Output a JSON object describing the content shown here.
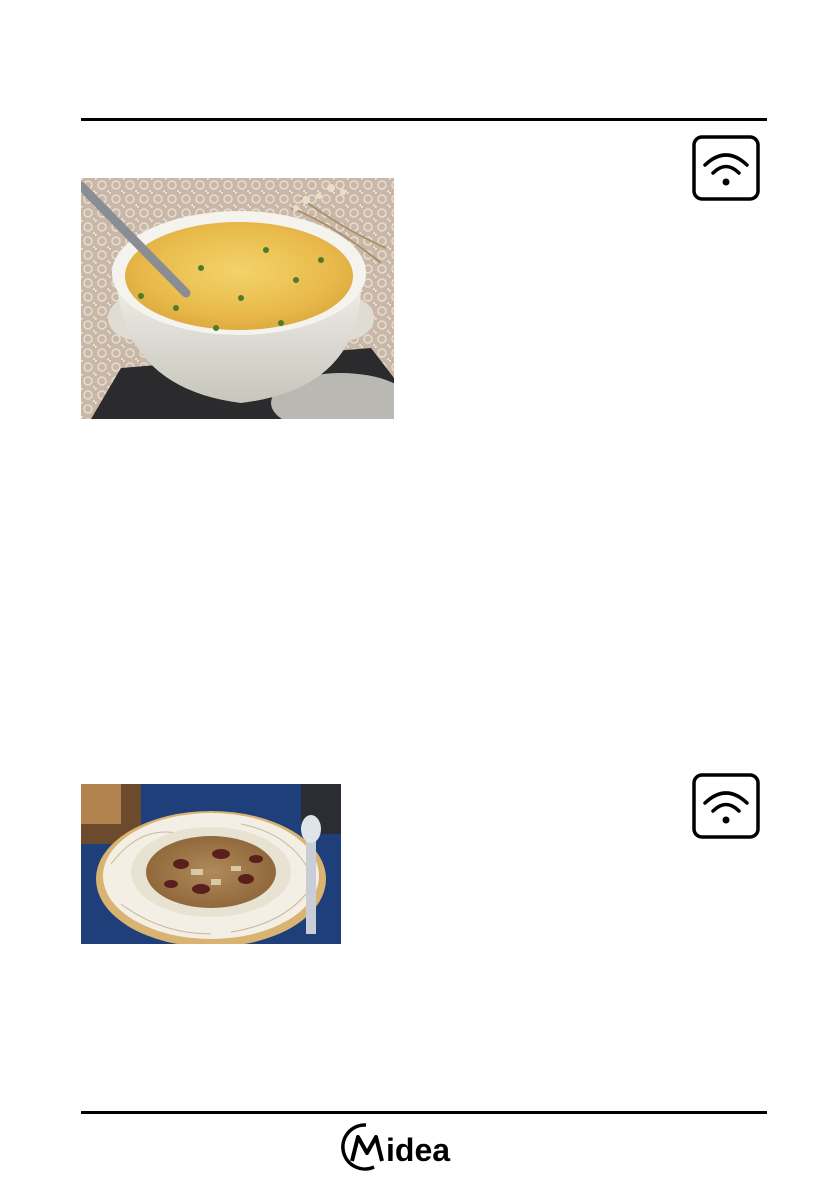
{
  "header": {
    "divider": "top-rule"
  },
  "sections": [
    {
      "photo": {
        "subject": "creamy-soup-photo"
      },
      "mode_icon": {
        "icon": "microwave-wave-icon"
      }
    },
    {
      "photo": {
        "subject": "bean-soup-photo"
      },
      "mode_icon": {
        "icon": "microwave-wave-icon"
      }
    }
  ],
  "footer": {
    "brand": "Midea",
    "colors": {
      "brand": "#000000"
    }
  }
}
